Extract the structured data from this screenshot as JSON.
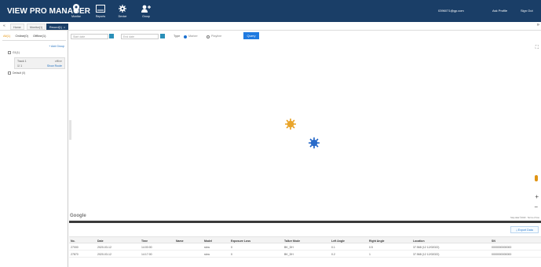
{
  "header": {
    "brand": "VIEW PRO MANAGER",
    "nav": [
      {
        "label": "Monitor",
        "icon": "map-pin-icon"
      },
      {
        "label": "Reports",
        "icon": "report-icon"
      },
      {
        "label": "Device",
        "icon": "gear-icon"
      },
      {
        "label": "Group",
        "icon": "group-icon"
      }
    ],
    "account": "0396071@gp.com",
    "profile": "Ask Profile",
    "signout": "Sign Out"
  },
  "tabs": [
    {
      "label": "Home",
      "active": false
    },
    {
      "label": "Monitor(1)",
      "active": false
    },
    {
      "label": "Record(1)",
      "active": true
    }
  ],
  "sidebar": {
    "tabs": {
      "all": "All(1)",
      "online": "Online(0)",
      "offline": "Offline(1)"
    },
    "add_group": "+ Add Group",
    "groups": [
      {
        "label": "G1(1)"
      },
      {
        "label": "Default (0)"
      }
    ],
    "device": {
      "name": "Track 1",
      "status": "offline",
      "count": "1",
      "show": "Show Route"
    }
  },
  "filter": {
    "start_placeholder": "Start date",
    "end_placeholder": "End date",
    "type_label": "Type",
    "options": [
      "Marker",
      "Playline"
    ],
    "query_label": "Query"
  },
  "map": {
    "google_label": "Google",
    "attribution": "Map data ©2020 · Terms of Use",
    "markers": [
      {
        "color": "#e8a020"
      },
      {
        "color": "#1f63c6"
      }
    ]
  },
  "table": {
    "export_label": "Export Data",
    "columns": [
      "No.",
      "Date",
      "Time",
      "Name",
      "Model",
      "Exposure Loss",
      "Talker Mode",
      "Left Angle",
      "Right Angle",
      "Location",
      "SN"
    ],
    "rows": [
      [
        "27000",
        "2020-03-12",
        "14:00:00",
        "",
        "slow",
        "0",
        "BK_DH",
        "0.1",
        "0.5",
        "37.568 (12 12/02022)",
        "0000000000000"
      ],
      [
        "27870",
        "2020-03-12",
        "14:17:00",
        "",
        "slow",
        "0",
        "BK_DH",
        "0.2",
        "1",
        "37.568 (12 12/02022)",
        "0000000000000"
      ]
    ]
  },
  "colors": {
    "header": "#1a3e67",
    "accent": "#e69512",
    "primary": "#1f7ae0"
  }
}
